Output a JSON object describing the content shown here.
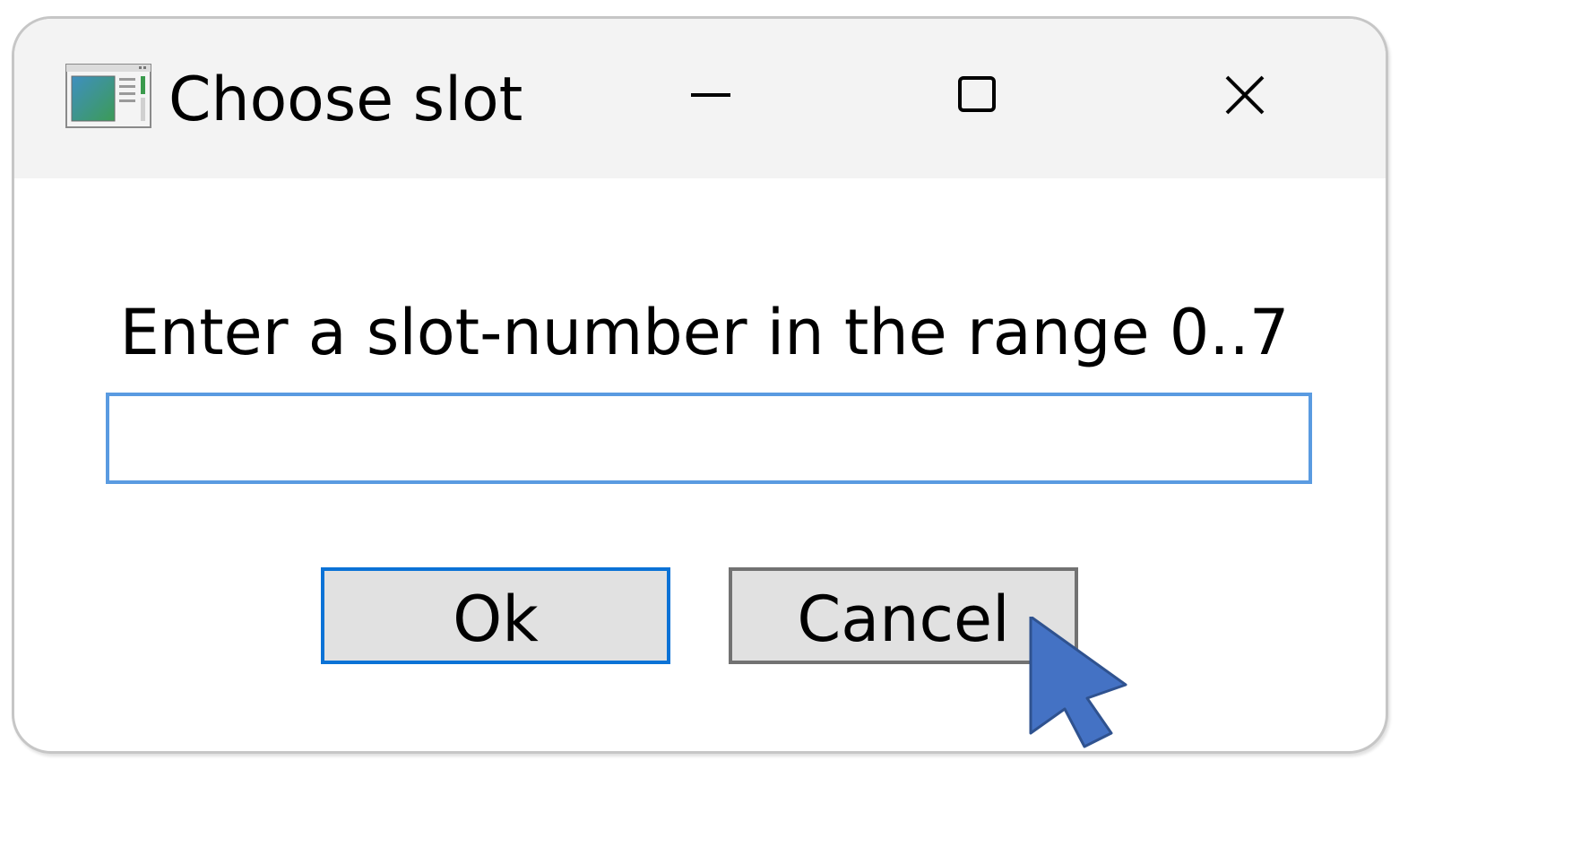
{
  "window": {
    "title": "Choose slot",
    "icon": "application-window-icon",
    "controls": {
      "minimize": "minimize-icon",
      "maximize": "maximize-icon",
      "close": "close-icon"
    }
  },
  "dialog": {
    "prompt": "Enter a slot-number in the range 0..7",
    "input": {
      "value": "",
      "placeholder": ""
    },
    "buttons": {
      "ok_label": "Ok",
      "cancel_label": "Cancel"
    }
  },
  "pointer": {
    "icon": "mouse-pointer-icon",
    "target": "cancel-button",
    "color": "#4472c4"
  },
  "colors": {
    "titlebar": "#f3f3f3",
    "input_border": "#5a9be1",
    "ok_border": "#0b72d6",
    "cancel_border": "#727272",
    "button_face": "#e1e1e1"
  }
}
